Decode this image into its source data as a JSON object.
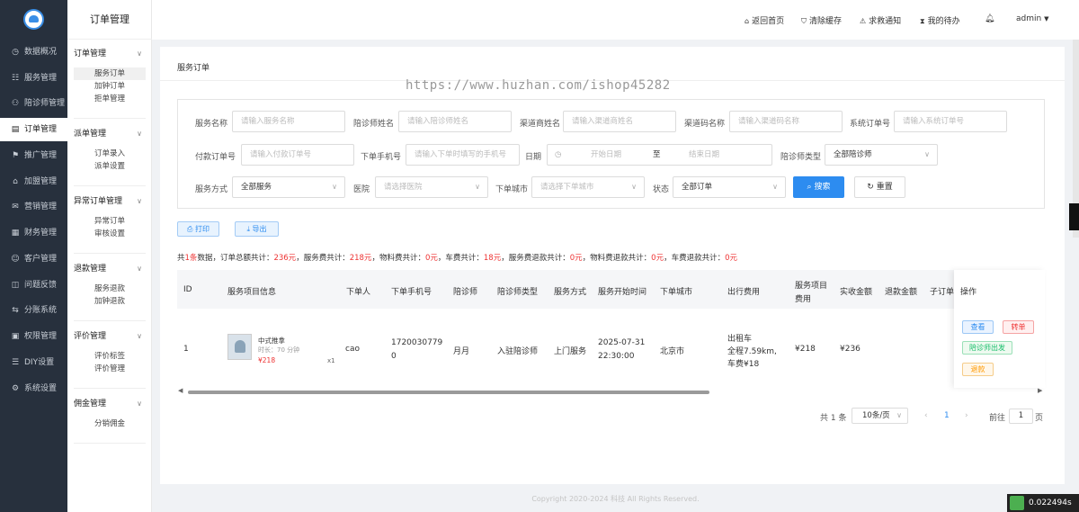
{
  "nav": {
    "items": [
      {
        "icon": "◷",
        "label": "数据概况"
      },
      {
        "icon": "☷",
        "label": "服务管理"
      },
      {
        "icon": "⚇",
        "label": "陪诊师管理"
      },
      {
        "icon": "▤",
        "label": "订单管理"
      },
      {
        "icon": "⚑",
        "label": "推广管理"
      },
      {
        "icon": "⌂",
        "label": "加盟管理"
      },
      {
        "icon": "✉",
        "label": "营销管理"
      },
      {
        "icon": "▦",
        "label": "财务管理"
      },
      {
        "icon": "☺",
        "label": "客户管理"
      },
      {
        "icon": "◫",
        "label": "问题反馈"
      },
      {
        "icon": "⇆",
        "label": "分账系统"
      },
      {
        "icon": "▣",
        "label": "权限管理"
      },
      {
        "icon": "☰",
        "label": "DIY设置"
      },
      {
        "icon": "⚙",
        "label": "系统设置"
      }
    ]
  },
  "submenu": {
    "title": "订单管理",
    "groups": [
      {
        "title": "订单管理",
        "items": [
          "服务订单",
          "加钟订单",
          "拒单管理"
        ]
      },
      {
        "title": "派单管理",
        "items": [
          "订单录入",
          "派单设置"
        ]
      },
      {
        "title": "异常订单管理",
        "items": [
          "异常订单",
          "审核设置"
        ]
      },
      {
        "title": "退款管理",
        "items": [
          "服务退款",
          "加钟退款"
        ]
      },
      {
        "title": "评价管理",
        "items": [
          "评价标签",
          "评价管理"
        ]
      },
      {
        "title": "佣金管理",
        "items": [
          "分销佣金"
        ]
      }
    ]
  },
  "header": {
    "home": "返回首页",
    "clear_cache": "清除缓存",
    "sos": "求救通知",
    "todo": "我的待办",
    "user": "admin"
  },
  "breadcrumb": "服务订单",
  "watermark": "https://www.huzhan.com/ishop45282",
  "filters": {
    "service_name": {
      "label": "服务名称",
      "placeholder": "请输入服务名称"
    },
    "escort_name": {
      "label": "陪诊师姓名",
      "placeholder": "请输入陪诊师姓名"
    },
    "channel_name": {
      "label": "渠道商姓名",
      "placeholder": "请输入渠道商姓名"
    },
    "channel_code": {
      "label": "渠道码名称",
      "placeholder": "请输入渠道码名称"
    },
    "order_no": {
      "label": "系统订单号",
      "placeholder": "请输入系统订单号"
    },
    "pay_no": {
      "label": "付款订单号",
      "placeholder": "请输入付款订单号"
    },
    "phone": {
      "label": "下单手机号",
      "placeholder": "请输入下单时填写的手机号"
    },
    "date": {
      "label": "日期",
      "start": "开始日期",
      "sep": "至",
      "end": "结束日期"
    },
    "escort_type": {
      "label": "陪诊师类型",
      "value": "全部陪诊师"
    },
    "service_mode": {
      "label": "服务方式",
      "value": "全部服务"
    },
    "hospital": {
      "label": "医院",
      "placeholder": "请选择医院"
    },
    "city": {
      "label": "下单城市",
      "placeholder": "请选择下单城市"
    },
    "status": {
      "label": "状态",
      "value": "全部订单"
    },
    "search": "搜索",
    "reset": "重置"
  },
  "actions": {
    "print": "打印",
    "export": "导出"
  },
  "summary": {
    "p1": "共",
    "count": "1条",
    "p2": "数据，订单总额共计：",
    "total": "236元",
    "p3": "，服务费共计：",
    "service_fee": "218元",
    "p4": "，物料费共计：",
    "material": "0元",
    "p5": "，车费共计：",
    "car": "18元",
    "p6": "，服务费退款共计：",
    "refund_service": "0元",
    "p7": "，物料费退款共计：",
    "refund_material": "0元",
    "p8": "，车费退款共计：",
    "refund_car": "0元"
  },
  "table": {
    "headers": [
      "ID",
      "服务项目信息",
      "下单人",
      "下单手机号",
      "陪诊师",
      "陪诊师类型",
      "服务方式",
      "服务开始时间",
      "下单城市",
      "出行费用",
      "服务项目",
      "费用",
      "实收金额",
      "退款金额",
      "子订单",
      "操作"
    ],
    "row": {
      "id": "1",
      "service_name": "中式推拿",
      "duration": "时长：70 分钟",
      "price": "¥218",
      "qty": "x1",
      "user": "cao",
      "phone1": "17200307790",
      "phone_wrap1": "1720030779",
      "phone_wrap2": "0",
      "escort": "月月",
      "escort_type": "入驻陪诊师",
      "mode": "上门服务",
      "start_date": "2025-07-31",
      "start_time": "22:30:00",
      "city": "北京市",
      "travel1": "出租车",
      "travel2": "全程7.59km,",
      "travel3": "车费¥18",
      "item_fee": "¥218",
      "received": "¥236"
    },
    "ops": {
      "view": "查看",
      "transfer": "转单",
      "depart": "陪诊师出发",
      "refund": "退款"
    }
  },
  "pager": {
    "total": "共 1 条",
    "size": "10条/页",
    "current": "1",
    "goto": "前往",
    "goto_value": "1",
    "page": "页"
  },
  "footer": "Copyright 2020-2024 科技 All Rights Reserved.",
  "timer": "0.022494s"
}
